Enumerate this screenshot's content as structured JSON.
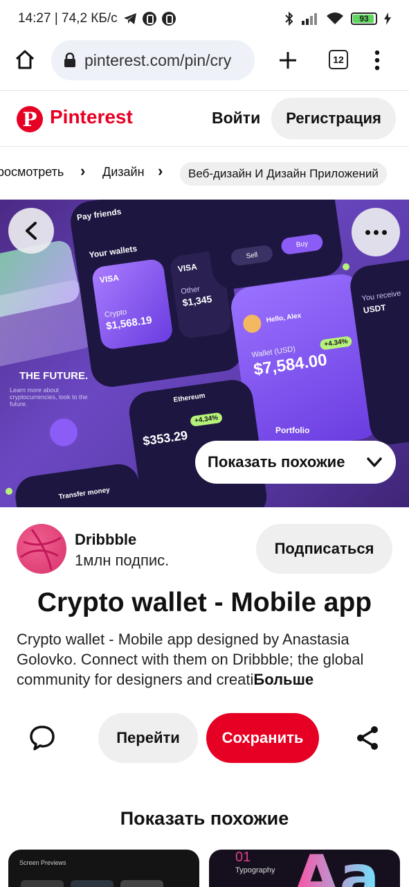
{
  "status_bar": {
    "time_info": "14:27 | 74,2 КБ/с",
    "battery": "93"
  },
  "browser": {
    "url": "pinterest.com/pin/cry",
    "tab_count": "12"
  },
  "header": {
    "brand": "Pinterest",
    "login_label": "Войти",
    "register_label": "Регистрация"
  },
  "breadcrumbs": {
    "items": [
      "росмотреть",
      "Дизайн",
      "Веб-дизайн И Дизайн Приложений"
    ]
  },
  "hero": {
    "show_similar_label": "Показать похожие",
    "mock_texts": {
      "pay_friends": "Pay friends",
      "your_wallets": "Your wallets",
      "visa1": "VISA",
      "visa2": "VISA",
      "crypto": "Crypto",
      "crypto_amount": "$1,568.19",
      "other": "Other",
      "other_amount": "$1,345",
      "hello": "Hello, Alex",
      "wallet_usd": "Wallet (USD)",
      "wallet_amount": "$7,584.00",
      "wallet_change": "+4.34%",
      "future": "THE FUTURE.",
      "future_sub": "Learn more about cryptocurrencies, look to the future.",
      "ethereum": "Ethereum",
      "eth_price": "$353.29",
      "eth_change": "+4.34%",
      "portfolio": "Portfolio",
      "transfer": "Transfer money",
      "sell": "Sell",
      "buy": "Buy",
      "you_receive": "You receive",
      "usdt": "USDT"
    }
  },
  "author": {
    "name": "Dribbble",
    "subscribers": "1млн подпис.",
    "subscribe_label": "Подписаться"
  },
  "pin": {
    "title": "Crypto wallet - Mobile app",
    "description": "Crypto wallet - Mobile app designed by Anastasia Golovko. Connect with them on Dribbble; the global community for designers and creati",
    "more_label": "Больше"
  },
  "actions": {
    "goto_label": "Перейти",
    "save_label": "Сохранить"
  },
  "similar": {
    "heading": "Показать похожие",
    "thumb1_text": "Screen Previews",
    "thumb2_number": "01",
    "thumb2_text": "Typography",
    "thumb2_letters": "Aa"
  },
  "colors": {
    "brand_red": "#e60023",
    "pill_gray": "#efefef",
    "hero_purple": "#6b48c2",
    "lime_chip": "#b6f27a"
  },
  "icons": [
    "home-icon",
    "lock-icon",
    "plus-icon",
    "tabs-icon",
    "menu-dots-icon",
    "back-arrow-icon",
    "more-dots-icon",
    "chevron-down-icon",
    "comment-icon",
    "share-icon"
  ]
}
